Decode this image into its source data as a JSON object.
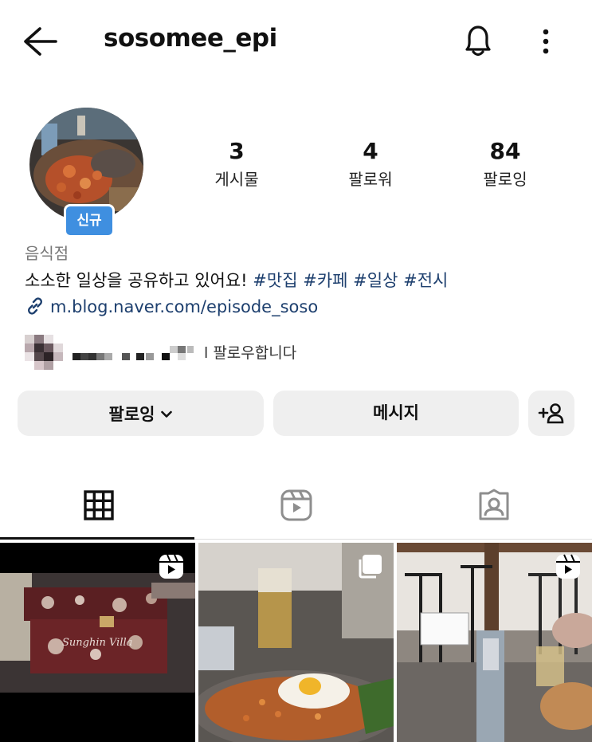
{
  "header": {
    "username": "sosomee_epi",
    "back_icon": "arrow-left-icon",
    "bell_icon": "bell-icon",
    "more_icon": "more-vertical-icon"
  },
  "profile": {
    "badge": "신규",
    "stats": [
      {
        "count": "3",
        "label": "게시물"
      },
      {
        "count": "4",
        "label": "팔로워"
      },
      {
        "count": "84",
        "label": "팔로잉"
      }
    ],
    "category": "음식점",
    "bio_text": "소소한 일상을 공유하고 있어요! ",
    "bio_tags": [
      "#맛집",
      "#카페",
      "#일상",
      "#전시"
    ],
    "link": "m.blog.naver.com/episode_soso",
    "followed_by_text": "l 팔로우합니다"
  },
  "actions": {
    "following_label": "팔로잉",
    "message_label": "메시지",
    "add_person_icon": "add-person-icon"
  },
  "tabs": [
    {
      "icon": "grid-icon",
      "active": true
    },
    {
      "icon": "reels-icon",
      "active": false
    },
    {
      "icon": "tagged-icon",
      "active": false
    }
  ],
  "posts": [
    {
      "type": "reel",
      "icon": "reels-icon",
      "watermark": "Sunghin Villa"
    },
    {
      "type": "carousel",
      "icon": "carousel-icon"
    },
    {
      "type": "reel",
      "icon": "reels-icon"
    }
  ],
  "colors": {
    "badge": "#3f8fe0",
    "link": "#1d3f6e",
    "button_bg": "#efefef"
  }
}
